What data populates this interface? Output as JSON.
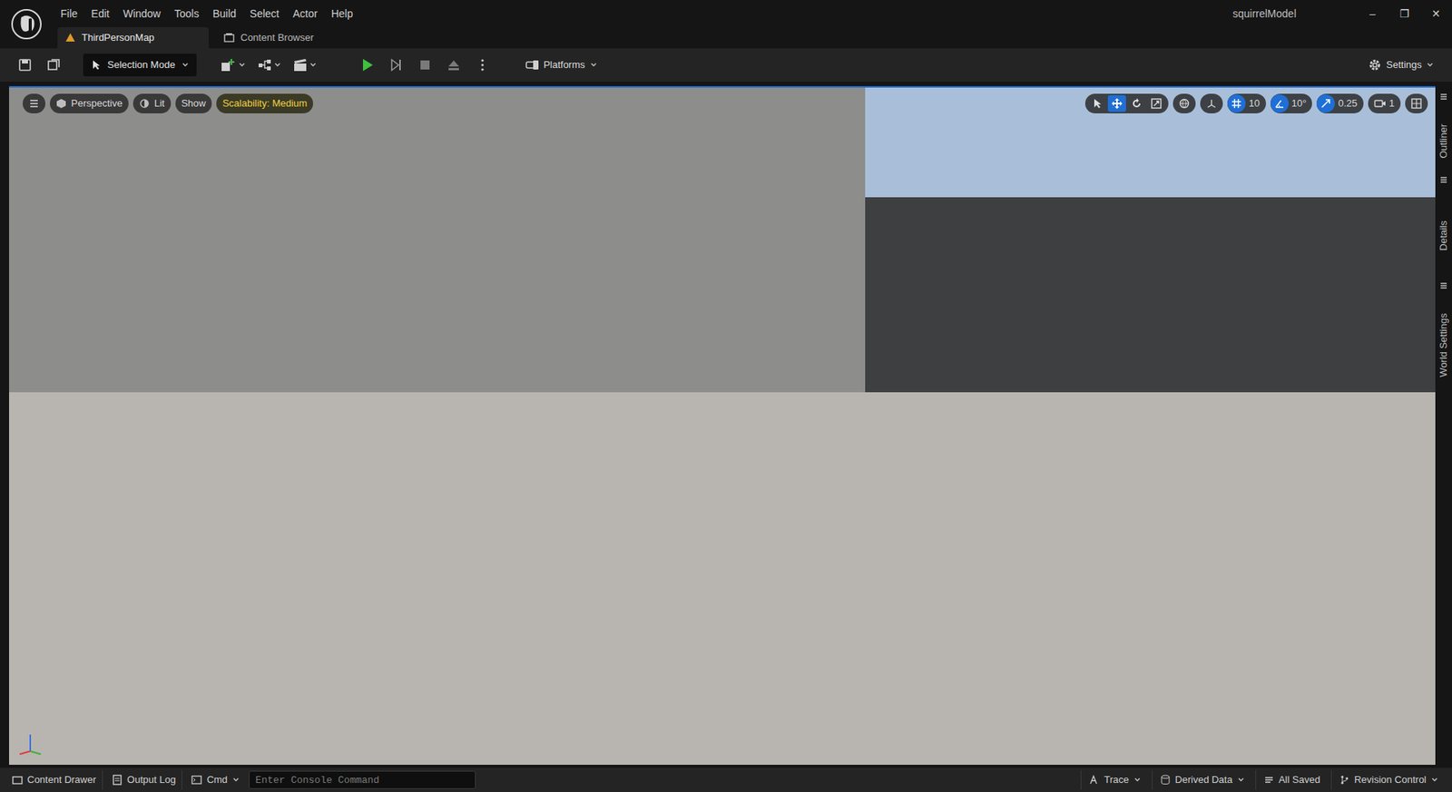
{
  "window": {
    "title": "squirrelModel",
    "controls": [
      "–",
      "❐",
      "✕"
    ]
  },
  "menu": [
    "File",
    "Edit",
    "Window",
    "Tools",
    "Build",
    "Select",
    "Actor",
    "Help"
  ],
  "tabs": [
    {
      "label": "ThirdPersonMap",
      "selected": true
    },
    {
      "label": "Content Browser",
      "selected": false
    }
  ],
  "toolbar": {
    "mode": "Selection Mode",
    "platforms": "Platforms",
    "settings": "Settings"
  },
  "viewport": {
    "view": "Perspective",
    "lighting": "Lit",
    "show": "Show",
    "scalability": "Scalability: Medium",
    "transform_tools": [
      {
        "kind": "select",
        "selected": false
      },
      {
        "kind": "move",
        "selected": true
      },
      {
        "kind": "rotate",
        "selected": false
      },
      {
        "kind": "scale",
        "selected": false
      }
    ],
    "snaps": [
      {
        "kind": "grid",
        "value": "10",
        "on": true
      },
      {
        "kind": "rotation",
        "value": "10°",
        "on": true
      },
      {
        "kind": "scale",
        "value": "0.25",
        "on": true
      }
    ],
    "camera_speed": "1"
  },
  "side_panels": [
    "Outliner",
    "Details",
    "World Settings"
  ],
  "status_bar": {
    "left": [
      "Content Drawer",
      "Output Log"
    ],
    "cmd": "Cmd",
    "console_placeholder": "Enter Console Command",
    "right": [
      "Trace",
      "Derived Data",
      "All Saved",
      "Revision Control"
    ]
  }
}
